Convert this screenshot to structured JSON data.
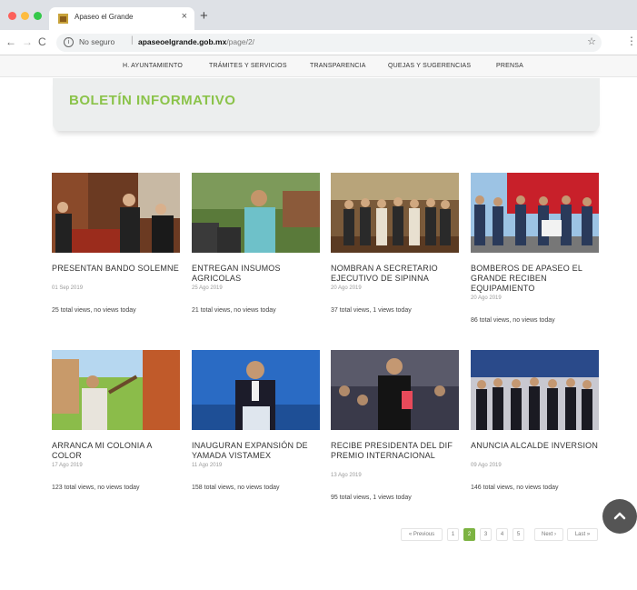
{
  "browser": {
    "tab_title": "Apaseo el Grande",
    "tab_close": "×",
    "new_tab": "+",
    "back": "←",
    "forward": "→",
    "reload": "C",
    "info": "i",
    "secure_text": "No seguro",
    "url_host": "apaseoelgrande.gob.mx",
    "url_path": "/page/2/",
    "star": "☆",
    "menu": "⋮"
  },
  "site_nav": {
    "items": [
      "H. AYUNTAMIENTO",
      "TRÁMITES Y SERVICIOS",
      "TRANSPARENCIA",
      "QUEJAS Y SUGERENCIAS",
      "PRENSA"
    ]
  },
  "banner": {
    "title": "BOLETÍN INFORMATIVO"
  },
  "posts": [
    {
      "title": "PRESENTAN BANDO SOLEMNE",
      "date": "01 Sep 2019",
      "views": "25 total views, no views today",
      "thumb_icon": "ceremony-photo"
    },
    {
      "title": "ENTREGAN INSUMOS AGRICOLAS",
      "date": "25 Ago 2019",
      "views": "21 total views, no views today",
      "thumb_icon": "speaker-photo"
    },
    {
      "title": "NOMBRAN A SECRETARIO EJECUTIVO DE SIPINNA",
      "date": "20 Ago 2019",
      "views": "37 total views, 1 views today",
      "thumb_icon": "group-photo"
    },
    {
      "title": "BOMBEROS DE APASEO EL GRANDE RECIBEN EQUIPAMIENTO",
      "date": "20 Ago 2019",
      "views": "86 total views, no views today",
      "thumb_icon": "firefighters-photo"
    },
    {
      "title": "ARRANCA MI COLONIA A COLOR",
      "date": "17 Ago 2019",
      "views": "123 total views, no views today",
      "thumb_icon": "painting-photo"
    },
    {
      "title": "INAUGURAN EXPANSIÓN DE YAMADA VISTAMEX",
      "date": "11 Ago 2019",
      "views": "158 total views, no views today",
      "thumb_icon": "podium-photo"
    },
    {
      "title": "RECIBE PRESIDENTA DEL DIF PREMIO INTERNACIONAL",
      "date": "13 Ago 2019",
      "views": "95 total views, 1 views today",
      "thumb_icon": "award-photo"
    },
    {
      "title": "ANUNCIA ALCALDE INVERSION",
      "date": "09 Ago 2019",
      "views": "146 total views, no views today",
      "thumb_icon": "officials-photo"
    }
  ],
  "pagination": {
    "items": [
      "« Previous",
      "1",
      "2",
      "3",
      "4",
      "5",
      "Next ›",
      "Last »"
    ],
    "current": "2"
  },
  "colors": {
    "accent": "#7cb342",
    "banner_title": "#8bc34a",
    "banner_bg": "#eceeee"
  }
}
